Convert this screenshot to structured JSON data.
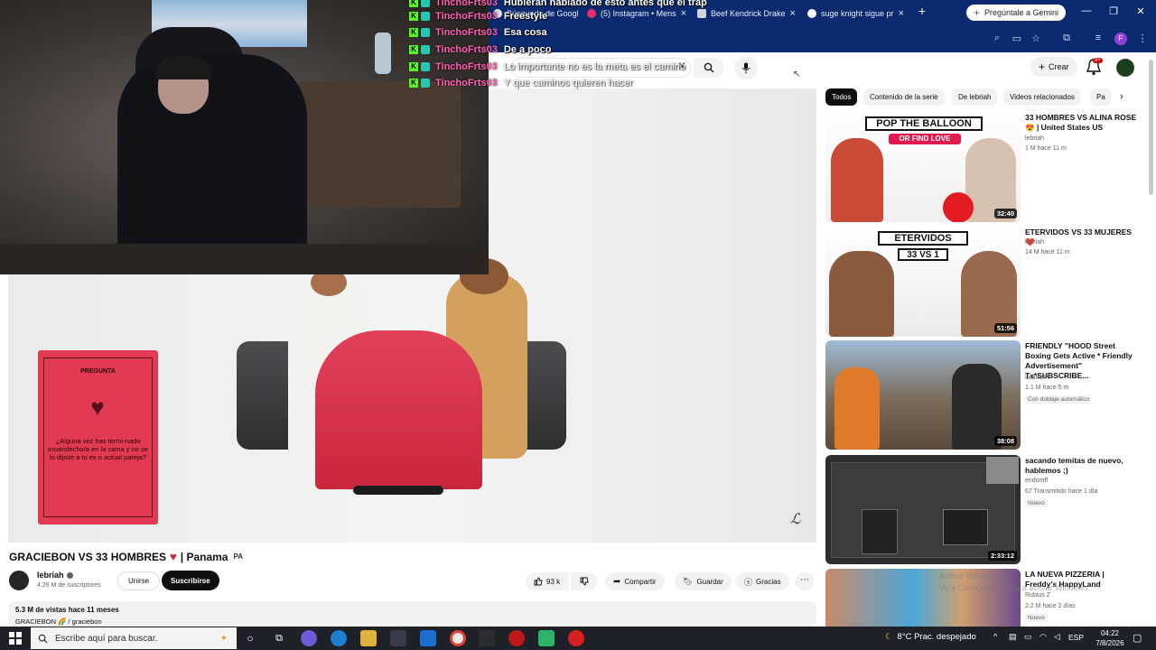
{
  "browser": {
    "tabs": [
      {
        "label": "Búsqueda de Google"
      },
      {
        "label": "(5) Instagram • Mens"
      },
      {
        "label": "Beef Kendrick Drake"
      },
      {
        "label": "suge knight sigue pr"
      }
    ],
    "new_tab": "+",
    "gemini_label": "Pregúntale a Gemini",
    "profile_initial": "F",
    "window_controls": {
      "minimize": "—",
      "maximize": "❐",
      "close": "✕"
    }
  },
  "chat": [
    {
      "user": "TinchoFrts03",
      "message": "Hubieran hablado de esto antes que el trap"
    },
    {
      "user": "TinchoFrts03",
      "message": "Freestyle"
    },
    {
      "user": "TinchoFrts03",
      "message": "Esa cosa"
    },
    {
      "user": "TinchoFrts03",
      "message": "De a poco"
    },
    {
      "user": "TinchoFrts03",
      "message": "Lo importante no es la meta es el camino"
    },
    {
      "user": "TinchoFrts03",
      "message": "Y que caminos quieren hacer"
    }
  ],
  "youtube": {
    "search_clear": "✕",
    "create_label": "Crear",
    "notification_count": "9+",
    "video_card": {
      "heading": "PREGUNTA",
      "question": "¿Alguna vez has termi-nado insatisfecho/a en la cama y no se lo dijiste a tu ex o actual pareja?"
    },
    "video": {
      "title": "GRACIEBON VS 33 HOMBRES",
      "title_suffix": "| Panama",
      "country_code": "PA",
      "channel_name": "lebriah",
      "subscribers": "4.26 M de suscriptores",
      "join_label": "Unirse",
      "subscribe_label": "Suscribirse",
      "likes": "93 k",
      "share_label": "Compartir",
      "save_label": "Guardar",
      "thanks_label": "Gracias",
      "stats": "5.3 M de vistas  hace 11 meses",
      "tags": "GRACIEBON  🌈 / graciebon"
    },
    "chips": [
      {
        "label": "Todos",
        "active": true
      },
      {
        "label": "Contenido de la serie",
        "active": false
      },
      {
        "label": "De lebriah",
        "active": false
      },
      {
        "label": "Videos relacionados",
        "active": false
      },
      {
        "label": "Pa",
        "active": false
      }
    ],
    "recommendations": [
      {
        "title": "33 HOMBRES VS ALINA ROSE 😍 | United States US",
        "channel": "lebriah",
        "stats": "1 M  hace 11 m",
        "duration": "32:40",
        "thumb_line1": "POP THE BALLOON",
        "thumb_line2": "OR FIND LOVE",
        "badge": ""
      },
      {
        "title": "ETERVIDOS VS 33 MUJERES ❤️",
        "channel": "lebriah",
        "stats": "14 M  hace 11 m",
        "duration": "51:56",
        "thumb_line1": "ETERVIDOS",
        "thumb_line2": "33 VS 1",
        "badge": ""
      },
      {
        "title": "FRIENDLY \"HOOD Street Boxing Gets Active * Friendly Advertisement\" Tx*SUBSCRIBE...",
        "channel": "LilBillsTv",
        "stats": "1.1 M  hace 5 m",
        "duration": "38:08",
        "thumb_line1": "",
        "thumb_line2": "",
        "badge": "Con doblaje automático"
      },
      {
        "title": "sacando temitas de nuevo, hablemos ;)",
        "channel": "endomff",
        "stats": "67  Transmitido hace 1 día",
        "duration": "2:33:12",
        "thumb_line1": "",
        "thumb_line2": "",
        "badge": "Nuevo"
      },
      {
        "title": "LA NUEVA PIZZERIA | Freddy's HappyLand",
        "channel": "Rubius Z",
        "stats": "2.2 M  hace 2 días",
        "duration": "",
        "thumb_line1": "",
        "thumb_line2": "",
        "badge": "Nuevo"
      }
    ]
  },
  "watermark": {
    "line1": "Activar Windows",
    "line2": "Ve a Configuración para activar Windows."
  },
  "taskbar": {
    "search_placeholder": "Escribe aquí para buscar.",
    "weather": "8°C  Prac. despejado",
    "language": "ESP",
    "time": "04:22",
    "date": "7/8/2026"
  },
  "colors": {
    "browser_chrome": "#0b2a6f",
    "kick_badge": "#53fc18",
    "chat_user": "#ff5fb3",
    "subscribe_bg": "#0f0f0f",
    "taskbar": "#1e2228"
  },
  "icons": {
    "search": "search-icon",
    "mic": "mic-icon",
    "bell": "bell-icon",
    "like": "thumbs-up-icon",
    "dislike": "thumbs-down-icon",
    "share": "share-icon",
    "save": "bookmark-icon",
    "thanks": "dollar-icon",
    "more": "more-icon",
    "windows": "windows-start-icon"
  }
}
